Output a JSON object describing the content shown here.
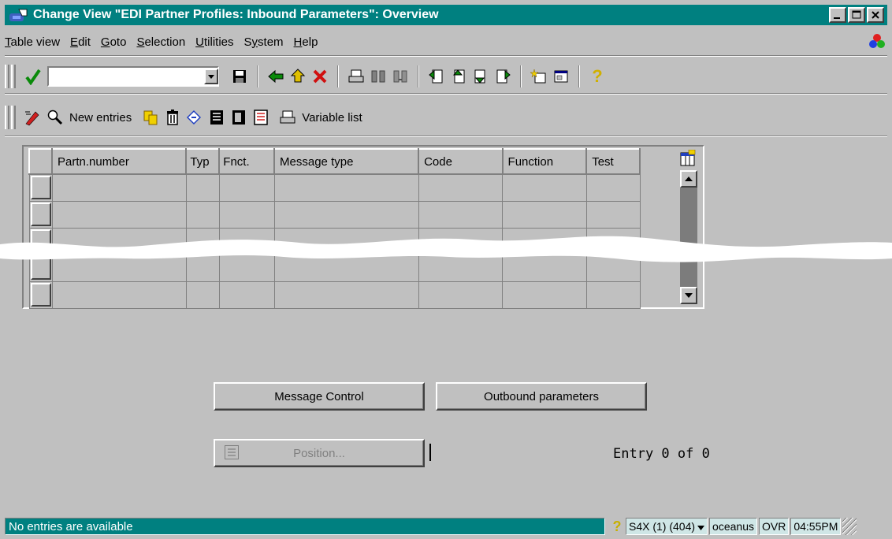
{
  "window": {
    "title": "Change View \"EDI Partner Profiles: Inbound Parameters\": Overview",
    "controls": [
      "minimize",
      "maximize",
      "close"
    ]
  },
  "menu": {
    "items": [
      {
        "label": "Table view",
        "mnemonic": "T"
      },
      {
        "label": "Edit",
        "mnemonic": "E"
      },
      {
        "label": "Goto",
        "mnemonic": "G"
      },
      {
        "label": "Selection",
        "mnemonic": "S"
      },
      {
        "label": "Utilities",
        "mnemonic": "U"
      },
      {
        "label": "System",
        "mnemonic": "y"
      },
      {
        "label": "Help",
        "mnemonic": "H"
      }
    ]
  },
  "standard_toolbar": {
    "command_field_value": "",
    "icons": [
      "enter-check-icon",
      "save-icon",
      "back-icon",
      "exit-icon",
      "cancel-icon",
      "print-icon",
      "find-icon",
      "find-next-icon",
      "first-page-icon",
      "previous-page-icon",
      "next-page-icon",
      "last-page-icon",
      "create-session-icon",
      "shortcut-icon",
      "help-icon"
    ]
  },
  "application_toolbar": {
    "new_entries_label": "New entries",
    "variable_list_label": "Variable list"
  },
  "table": {
    "columns": [
      "Partn.number",
      "Typ",
      "Fnct.",
      "Message type",
      "Code",
      "Function",
      "Test"
    ],
    "rows": [
      [
        "",
        "",
        "",
        "",
        "",
        "",
        ""
      ],
      [
        "",
        "",
        "",
        "",
        "",
        "",
        ""
      ],
      [
        "",
        "",
        "",
        "",
        "",
        "",
        ""
      ],
      [
        "",
        "",
        "",
        "",
        "",
        "",
        ""
      ],
      [
        "",
        "",
        "",
        "",
        "",
        "",
        ""
      ]
    ]
  },
  "buttons": {
    "message_control": "Message Control",
    "outbound_parameters": "Outbound parameters",
    "position": "Position..."
  },
  "entry_info": "Entry 0 of 0",
  "status_bar": {
    "message": "No entries are available",
    "system": "S4X (1) (404)",
    "server": "oceanus",
    "mode": "OVR",
    "time": "04:55PM"
  },
  "colors": {
    "title_bar": "#008080",
    "window_bg": "#c0c0c0",
    "status_message_bg": "#008080"
  }
}
